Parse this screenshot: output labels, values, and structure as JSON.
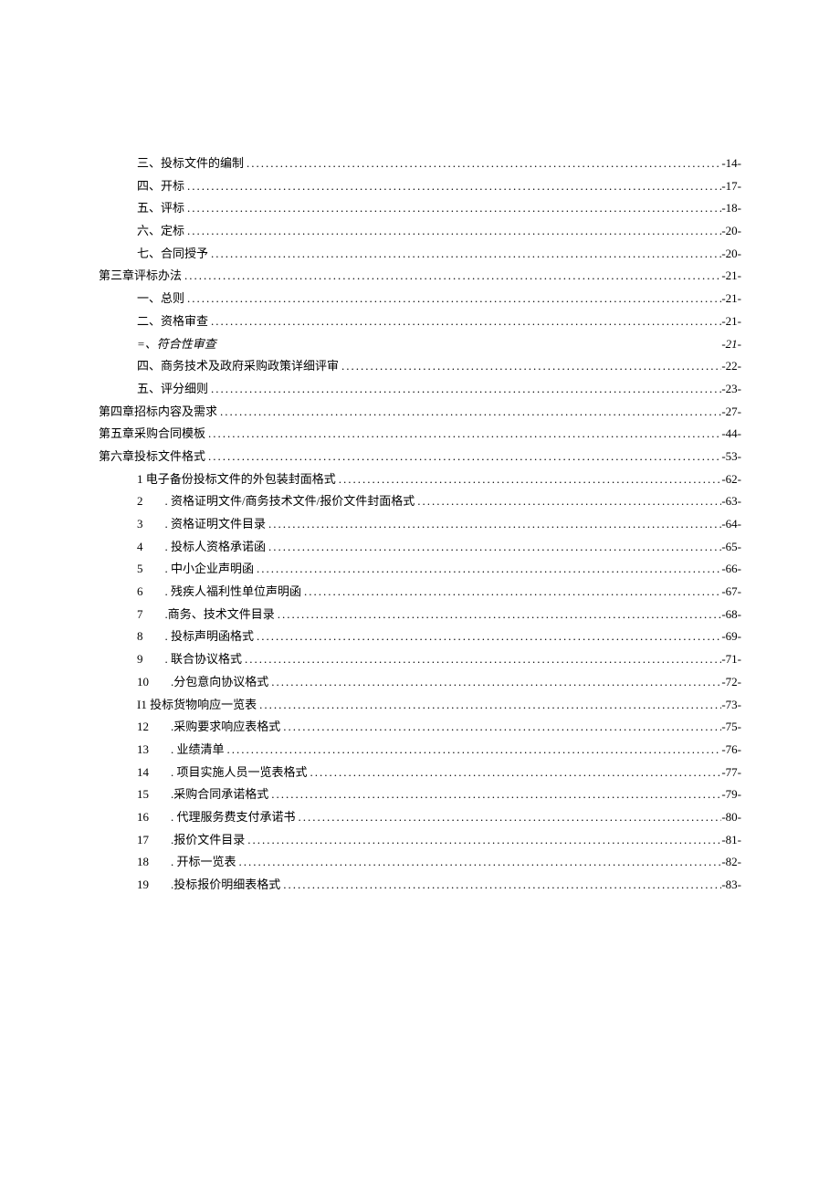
{
  "entries": [
    {
      "indent": 1,
      "num": "",
      "label": "三、投标文件的编制",
      "page": "-14-",
      "dots": true
    },
    {
      "indent": 1,
      "num": "",
      "label": "四、开标",
      "page": "-17-",
      "dots": true
    },
    {
      "indent": 1,
      "num": "",
      "label": "五、评标",
      "page": "-18-",
      "dots": true
    },
    {
      "indent": 1,
      "num": "",
      "label": "六、定标",
      "page": "-20-",
      "dots": true
    },
    {
      "indent": 1,
      "num": "",
      "label": "七、合同授予",
      "page": "-20-",
      "dots": true
    },
    {
      "indent": 0,
      "num": "",
      "label": "第三章评标办法",
      "page": "-21-",
      "dots": true
    },
    {
      "indent": 1,
      "num": "",
      "label": "一、总则",
      "page": "-21-",
      "dots": true
    },
    {
      "indent": 1,
      "num": "",
      "label": "二、资格审查",
      "page": "-21-",
      "dots": true
    },
    {
      "indent": 1,
      "num": "",
      "label": "=、符合性审查",
      "page": "-21-",
      "dots": false,
      "italic": true
    },
    {
      "indent": 1,
      "num": "",
      "label": "四、商务技术及政府采购政策详细评审",
      "page": "-22-",
      "dots": true
    },
    {
      "indent": 1,
      "num": "",
      "label": "五、评分细则",
      "page": "-23-",
      "dots": true
    },
    {
      "indent": 0,
      "num": "",
      "label": "第四章招标内容及需求",
      "page": "-27-",
      "dots": true
    },
    {
      "indent": 0,
      "num": "",
      "label": "第五章采购合同模板",
      "page": "-44-",
      "dots": true
    },
    {
      "indent": 0,
      "num": "",
      "label": "第六章投标文件格式",
      "page": "-53-",
      "dots": true
    },
    {
      "indent": 1,
      "num": "",
      "label": "1 电子备份投标文件的外包装封面格式",
      "page": "-62-",
      "dots": true
    },
    {
      "indent": 2,
      "num": "2",
      "label": ". 资格证明文件/商务技术文件/报价文件封面格式",
      "page": "-63-",
      "dots": true
    },
    {
      "indent": 2,
      "num": "3",
      "label": ". 资格证明文件目录",
      "page": "-64-",
      "dots": true
    },
    {
      "indent": 2,
      "num": "4",
      "label": ". 投标人资格承诺函",
      "page": "-65-",
      "dots": true
    },
    {
      "indent": 2,
      "num": "5",
      "label": ". 中小企业声明函",
      "page": "-66-",
      "dots": true
    },
    {
      "indent": 2,
      "num": "6",
      "label": ". 残疾人福利性单位声明函",
      "page": "-67-",
      "dots": true
    },
    {
      "indent": 2,
      "num": "7",
      "label": ".商务、技术文件目录",
      "page": "-68-",
      "dots": true
    },
    {
      "indent": 2,
      "num": "8",
      "label": ". 投标声明函格式",
      "page": "-69-",
      "dots": true
    },
    {
      "indent": 2,
      "num": "9",
      "label": ". 联合协议格式",
      "page": "-71-",
      "dots": true
    },
    {
      "indent": 2,
      "num": "10",
      "label": ".分包意向协议格式",
      "page": "-72-",
      "dots": true
    },
    {
      "indent": 1,
      "num": "",
      "label": "I1 投标货物响应一览表",
      "page": "-73-",
      "dots": true
    },
    {
      "indent": 2,
      "num": "12",
      "label": ".采购要求响应表格式",
      "page": "-75-",
      "dots": true
    },
    {
      "indent": 2,
      "num": "13",
      "label": ". 业绩清单",
      "page": "-76-",
      "dots": true
    },
    {
      "indent": 2,
      "num": "14",
      "label": ". 项目实施人员一览表格式",
      "page": "-77-",
      "dots": true
    },
    {
      "indent": 2,
      "num": "15",
      "label": ".采购合同承诺格式",
      "page": "-79-",
      "dots": true
    },
    {
      "indent": 2,
      "num": "16",
      "label": ". 代理服务费支付承诺书",
      "page": "-80-",
      "dots": true
    },
    {
      "indent": 2,
      "num": "17",
      "label": ".报价文件目录",
      "page": "-81-",
      "dots": true
    },
    {
      "indent": 2,
      "num": "18",
      "label": ". 开标一览表",
      "page": "-82-",
      "dots": true
    },
    {
      "indent": 2,
      "num": "19",
      "label": ".投标报价明细表格式",
      "page": "-83-",
      "dots": true
    }
  ]
}
